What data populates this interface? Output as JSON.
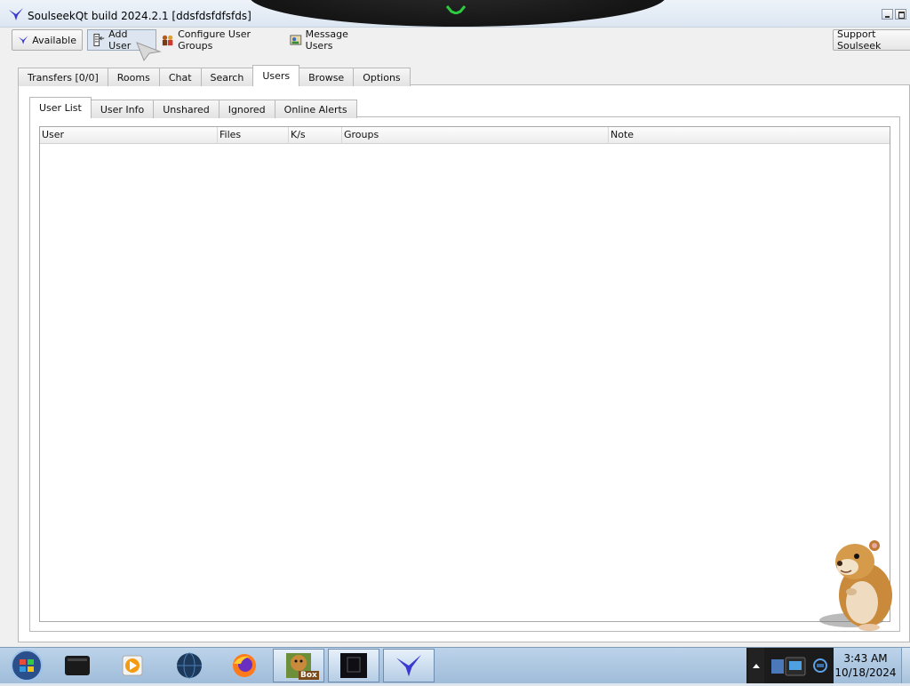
{
  "window": {
    "title": "SoulseekQt build 2024.2.1 [ddsfdsfdfsfds]"
  },
  "toolbar": {
    "status_label": "Available",
    "add_user_label": "Add User",
    "configure_groups_label": "Configure User Groups",
    "message_users_label": "Message Users",
    "support_label": "Support Soulseek"
  },
  "tabs": [
    {
      "label": "Transfers [0/0]"
    },
    {
      "label": "Rooms"
    },
    {
      "label": "Chat"
    },
    {
      "label": "Search"
    },
    {
      "label": "Users",
      "active": true
    },
    {
      "label": "Browse"
    },
    {
      "label": "Options"
    }
  ],
  "subtabs": [
    {
      "label": "User List",
      "active": true
    },
    {
      "label": "User Info"
    },
    {
      "label": "Unshared"
    },
    {
      "label": "Ignored"
    },
    {
      "label": "Online Alerts"
    }
  ],
  "table": {
    "columns": [
      {
        "label": "User"
      },
      {
        "label": "Files"
      },
      {
        "label": "K/s"
      },
      {
        "label": "Groups"
      },
      {
        "label": "Note"
      }
    ],
    "rows": []
  },
  "taskbar": {
    "clock_time": "3:43 AM",
    "clock_date": "10/18/2024",
    "box_label": "Box"
  },
  "colors": {
    "accent": "#3a3ad0",
    "taskbar": "#a9c3dd",
    "title_arc": "#1a1a1a"
  }
}
